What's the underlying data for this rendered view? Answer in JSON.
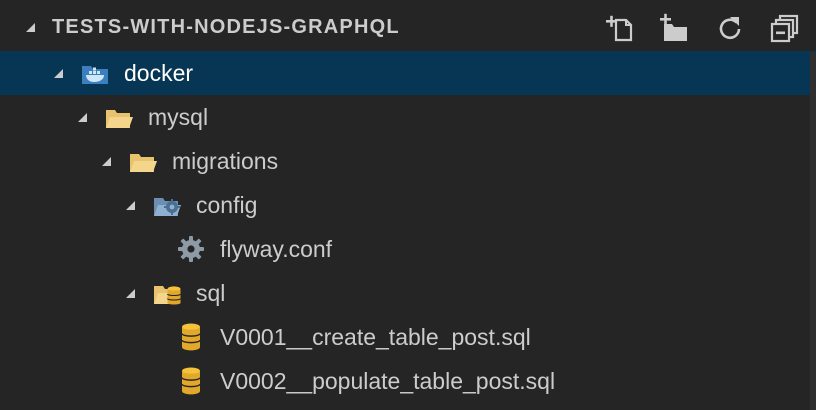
{
  "explorer": {
    "section_title": "TESTS-WITH-NODEJS-GRAPHQL",
    "actions": [
      {
        "name": "new-file-icon"
      },
      {
        "name": "new-folder-icon"
      },
      {
        "name": "refresh-icon"
      },
      {
        "name": "collapse-all-icon"
      }
    ]
  },
  "tree": {
    "items": [
      {
        "label": "docker",
        "icon": "docker-folder-icon",
        "expanded": true,
        "selected": true
      },
      {
        "label": "mysql",
        "icon": "folder-open-icon",
        "expanded": true
      },
      {
        "label": "migrations",
        "icon": "folder-open-icon",
        "expanded": true
      },
      {
        "label": "config",
        "icon": "config-folder-icon",
        "expanded": true
      },
      {
        "label": "flyway.conf",
        "icon": "gear-icon"
      },
      {
        "label": "sql",
        "icon": "database-folder-icon",
        "expanded": true
      },
      {
        "label": "V0001__create_table_post.sql",
        "icon": "database-icon"
      },
      {
        "label": "V0002__populate_table_post.sql",
        "icon": "database-icon"
      }
    ]
  },
  "colors": {
    "background": "#252526",
    "selection": "#073655",
    "folder": "#e8c26c",
    "docker_folder": "#3b7fbf",
    "config_folder": "#6a8fb3",
    "text": "#cccccc"
  }
}
